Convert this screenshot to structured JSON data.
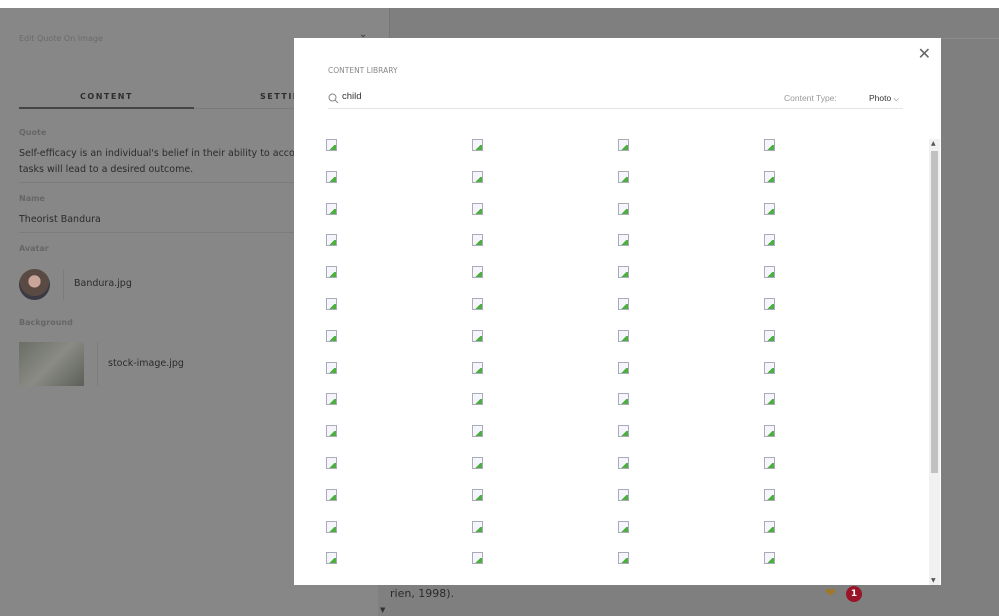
{
  "panel": {
    "title": "Edit Quote On Image",
    "tabs": [
      "CONTENT",
      "SETTINGS"
    ],
    "quote_label": "Quote",
    "quote_value": "Self-efficacy is an individual's belief in their ability to accomplish certain tasks and that achieving those tasks will lead to a desired outcome.",
    "name_label": "Name",
    "name_value": "Theorist Bandura",
    "avatar_label": "Avatar",
    "avatar_file": "Bandura.jpg",
    "background_label": "Background",
    "background_file": "stock-image.jpg"
  },
  "behind_text": "rien, 1998).",
  "notification_count": "1",
  "modal": {
    "title": "CONTENT LIBRARY",
    "search_value": "child",
    "content_type_label": "Content Type:",
    "content_type_value": "Photo",
    "columns": 4,
    "result_rows_visible": 14
  }
}
